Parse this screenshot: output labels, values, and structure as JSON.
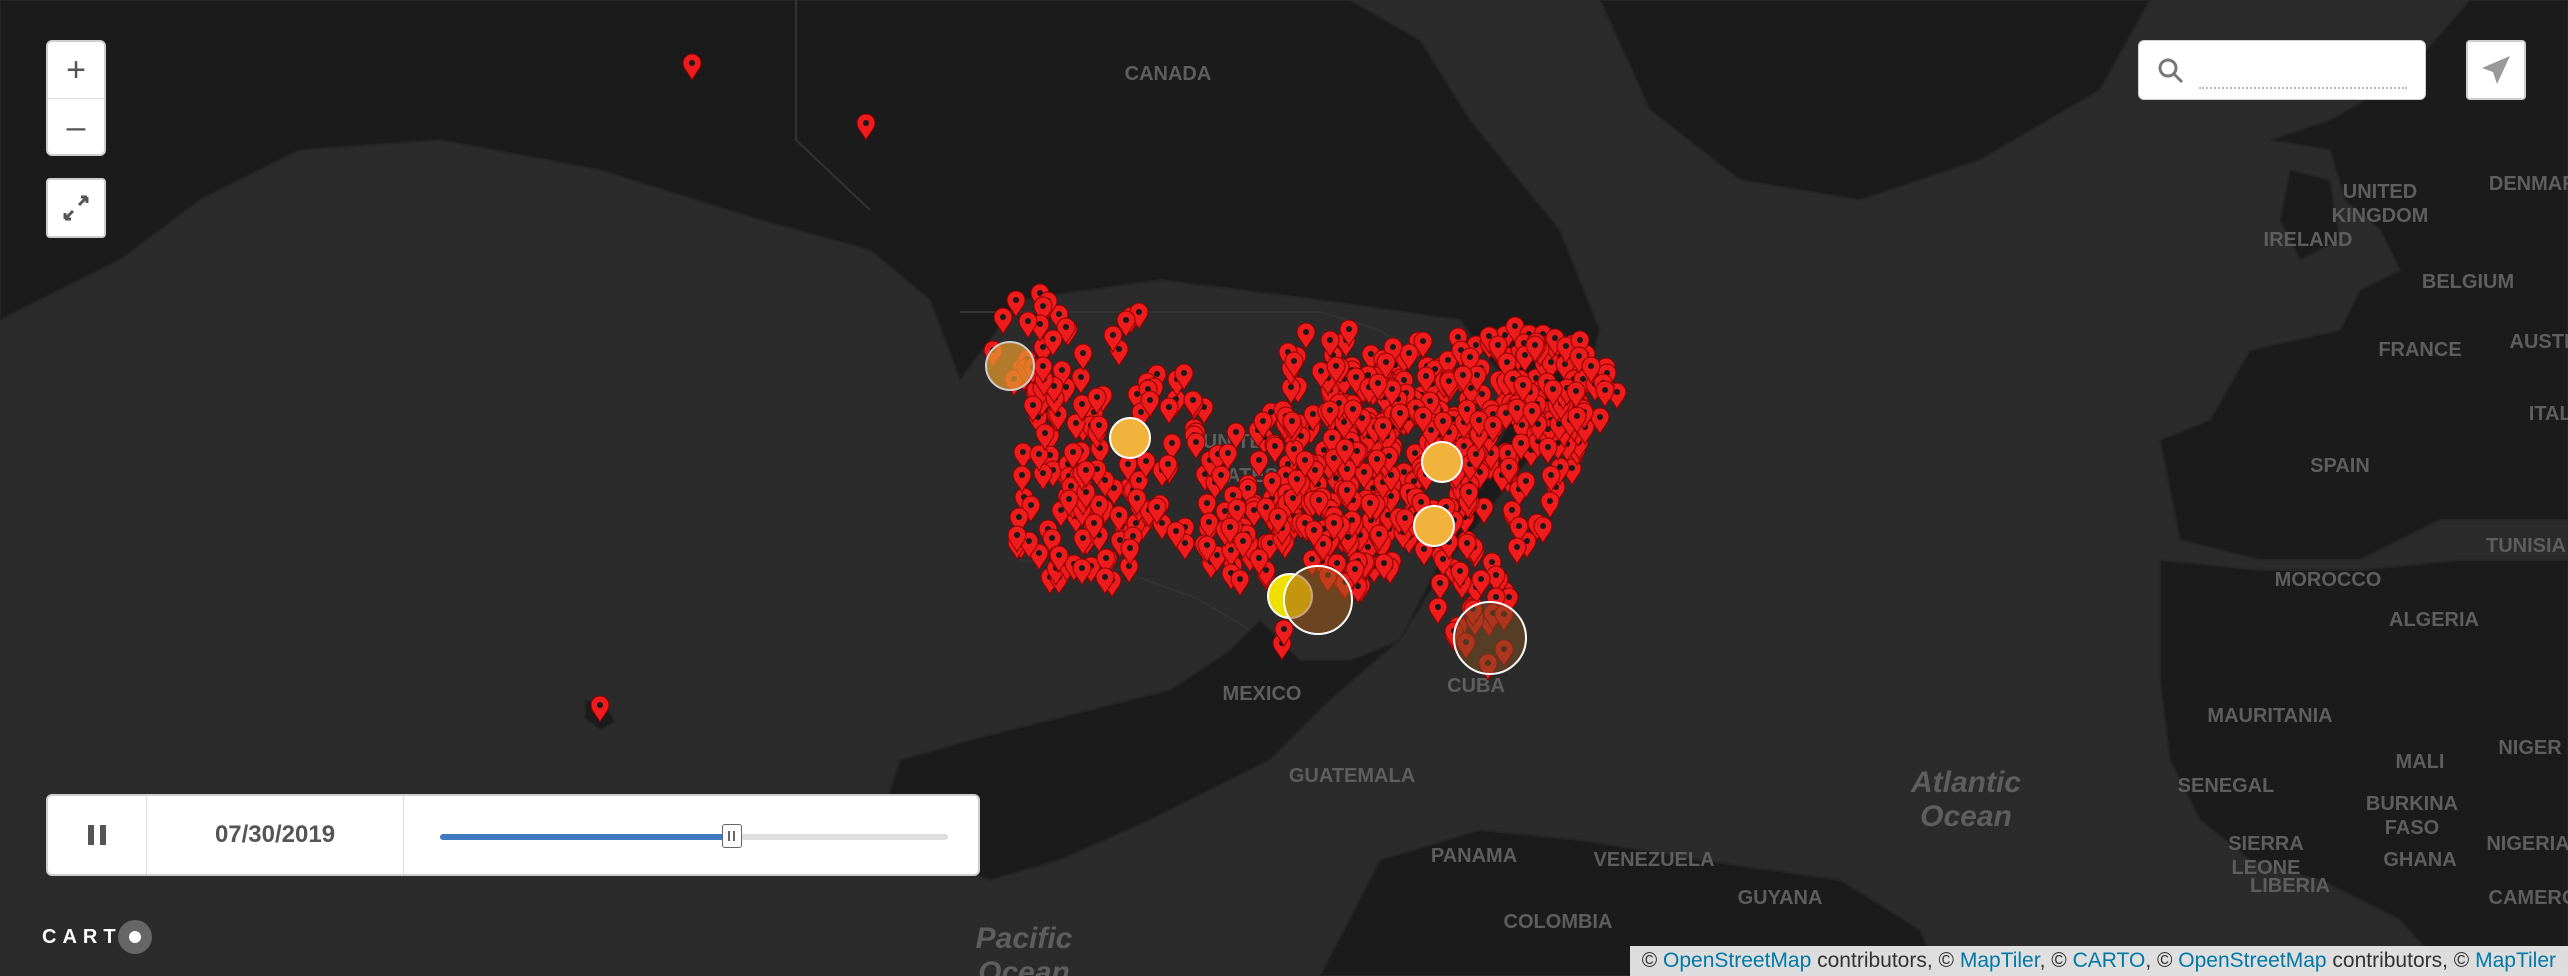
{
  "map": {
    "land_color": "#1b1b1b",
    "water_color": "#2b2b2b",
    "marker_color": "#ee1c1c",
    "country_labels": [
      {
        "key": "canada",
        "text": "CANADA"
      },
      {
        "key": "united-states",
        "text": "UNITED STATES"
      },
      {
        "key": "mexico",
        "text": "MEXICO"
      },
      {
        "key": "cuba",
        "text": "CUBA"
      },
      {
        "key": "guatemala",
        "text": "GUATEMALA"
      },
      {
        "key": "panama",
        "text": "PANAMA"
      },
      {
        "key": "venezuela",
        "text": "VENEZUELA"
      },
      {
        "key": "colombia",
        "text": "COLOMBIA"
      },
      {
        "key": "guyana",
        "text": "GUYANA"
      },
      {
        "key": "united-kingdom",
        "text": "UNITED KINGDOM"
      },
      {
        "key": "ireland",
        "text": "IRELAND"
      },
      {
        "key": "belgium",
        "text": "BELGIUM"
      },
      {
        "key": "france",
        "text": "FRANCE"
      },
      {
        "key": "spain",
        "text": "SPAIN"
      },
      {
        "key": "morocco",
        "text": "MOROCCO"
      },
      {
        "key": "algeria",
        "text": "ALGERIA"
      },
      {
        "key": "tunisia",
        "text": "TUNISIA"
      },
      {
        "key": "mauritania",
        "text": "MAURITANIA"
      },
      {
        "key": "mali",
        "text": "MALI"
      },
      {
        "key": "niger",
        "text": "NIGER"
      },
      {
        "key": "senegal",
        "text": "SENEGAL"
      },
      {
        "key": "burkina-faso",
        "text": "BURKINA FASO"
      },
      {
        "key": "sierra-leone",
        "text": "SIERRA LEONE"
      },
      {
        "key": "liberia",
        "text": "LIBERIA"
      },
      {
        "key": "ghana",
        "text": "GHANA"
      },
      {
        "key": "nigeria",
        "text": "NIGERIA"
      },
      {
        "key": "denmark",
        "text": "DENMARK"
      },
      {
        "key": "italy",
        "text": "ITALY"
      },
      {
        "key": "austria",
        "text": "AUSTRIA"
      },
      {
        "key": "cameroon",
        "text": "CAMEROON"
      }
    ],
    "ocean_labels": [
      {
        "key": "atlantic",
        "text": "Atlantic Ocean"
      },
      {
        "key": "pacific",
        "text": "Pacific Ocean"
      }
    ]
  },
  "controls": {
    "zoom_in": "+",
    "zoom_out": "–",
    "fullscreen_icon": "fullscreen-icon",
    "search_icon": "search-icon",
    "search_placeholder": "",
    "locate_icon": "paper-plane-icon"
  },
  "timeline": {
    "pause_icon": "pause-icon",
    "date": "07/30/2019",
    "progress": 0.575,
    "fill_color": "#3e7bbf"
  },
  "logo": {
    "text": "CART"
  },
  "attribution": {
    "prefix": "© ",
    "osm": "OpenStreetMap",
    "contrib1": " contributors, © ",
    "maptiler": "MapTiler",
    "sep1": ", © ",
    "carto": "CARTO",
    "sep2": ", © ",
    "osm2": "OpenStreetMap",
    "contrib2": " contributors, © ",
    "maptiler2": "MapTiler"
  }
}
